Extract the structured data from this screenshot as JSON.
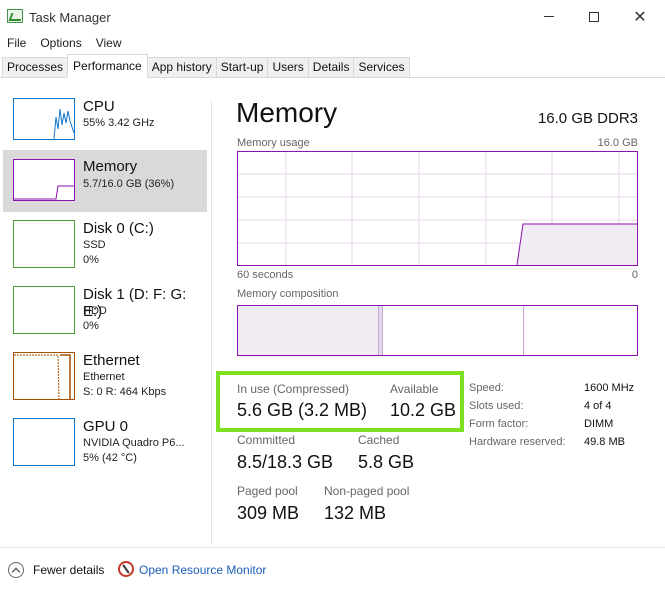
{
  "window": {
    "title": "Task Manager",
    "controls": {
      "minimize": "minimize",
      "maximize": "maximize",
      "close": "✕"
    }
  },
  "menu": [
    "File",
    "Options",
    "View"
  ],
  "tabs": [
    "Processes",
    "Performance",
    "App history",
    "Start-up",
    "Users",
    "Details",
    "Services"
  ],
  "active_tab": "Performance",
  "sidebar": [
    {
      "title": "CPU",
      "line1": "55%  3.42 GHz",
      "line2": "",
      "color": "#1176c8"
    },
    {
      "title": "Memory",
      "line1": "5.7/16.0 GB (36%)",
      "line2": "",
      "color": "#8b12ae",
      "selected": true
    },
    {
      "title": "Disk 0 (C:)",
      "line1": "SSD",
      "line2": "0%",
      "color": "#4da033"
    },
    {
      "title": "Disk 1 (D: F: G: E:)",
      "line1": "HDD",
      "line2": "0%",
      "color": "#4da033"
    },
    {
      "title": "Ethernet",
      "line1": "Ethernet",
      "line2": "S: 0 R: 464 Kbps",
      "color": "#a74f01"
    },
    {
      "title": "GPU 0",
      "line1": "NVIDIA Quadro P6...",
      "line2": "5% (42 °C)",
      "color": "#1176c8"
    }
  ],
  "detail": {
    "heading": "Memory",
    "mem_type": "16.0 GB DDR3",
    "usage_label": "Memory usage",
    "usage_max": "16.0 GB",
    "time_left": "60 seconds",
    "time_right": "0",
    "composition_label": "Memory composition",
    "in_use_label": "In use (Compressed)",
    "in_use_value": "5.6 GB (3.2 MB)",
    "available_label": "Available",
    "available_value": "10.2 GB",
    "committed_label": "Committed",
    "committed_value": "8.5/18.3 GB",
    "cached_label": "Cached",
    "cached_value": "5.8 GB",
    "paged_label": "Paged pool",
    "paged_value": "309 MB",
    "nonpaged_label": "Non-paged pool",
    "nonpaged_value": "132 MB",
    "specs": [
      {
        "label": "Speed:",
        "value": "1600 MHz"
      },
      {
        "label": "Slots used:",
        "value": "4 of 4"
      },
      {
        "label": "Form factor:",
        "value": "DIMM"
      },
      {
        "label": "Hardware reserved:",
        "value": "49.8 MB"
      }
    ]
  },
  "footer": {
    "fewer_details": "Fewer details",
    "open_monitor": "Open Resource Monitor"
  },
  "colors": {
    "accent": "#8b12ae",
    "highlight": "#7ee022",
    "link": "#1a5fb4"
  }
}
